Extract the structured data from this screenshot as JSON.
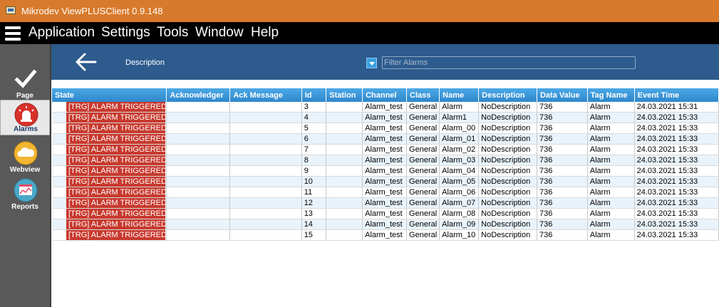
{
  "window": {
    "title": "Mikrodev ViewPLUSClient 0.9.148"
  },
  "menu": {
    "items": [
      "Application",
      "Settings",
      "Tools",
      "Window",
      "Help"
    ]
  },
  "sidebar": {
    "items": [
      {
        "label": "Page",
        "icon": "check-icon"
      },
      {
        "label": "Alarms",
        "icon": "alarm-light-icon",
        "active": true
      },
      {
        "label": "Webview",
        "icon": "cloud-icon"
      },
      {
        "label": "Reports",
        "icon": "report-chart-icon"
      }
    ]
  },
  "header": {
    "description_label": "Description",
    "filter_placeholder": "Filter Alarms"
  },
  "colors": {
    "accent": "#2d5b8d",
    "titlebar": "#d87a2c",
    "alarm": "#c8392e",
    "table_header": "#3a96d8"
  },
  "table": {
    "columns": [
      "State",
      "Acknowledger",
      "Ack Message",
      "Id",
      "Station",
      "Channel",
      "Class",
      "Name",
      "Description",
      "Data Value",
      "Tag Name",
      "Event Time"
    ],
    "rows": [
      [
        "[TRG] ALARM TRIGGERED",
        "",
        "",
        "3",
        "",
        "Alarm_test",
        "General",
        "Alarm",
        "NoDescription",
        "736",
        "Alarm",
        "24.03.2021 15:31"
      ],
      [
        "[TRG] ALARM TRIGGERED",
        "",
        "",
        "4",
        "",
        "Alarm_test",
        "General",
        "Alarm1",
        "NoDescription",
        "736",
        "Alarm",
        "24.03.2021 15:33"
      ],
      [
        "[TRG] ALARM TRIGGERED",
        "",
        "",
        "5",
        "",
        "Alarm_test",
        "General",
        "Alarm_00",
        "NoDescription",
        "736",
        "Alarm",
        "24.03.2021 15:33"
      ],
      [
        "[TRG] ALARM TRIGGERED",
        "",
        "",
        "6",
        "",
        "Alarm_test",
        "General",
        "Alarm_01",
        "NoDescription",
        "736",
        "Alarm",
        "24.03.2021 15:33"
      ],
      [
        "[TRG] ALARM TRIGGERED",
        "",
        "",
        "7",
        "",
        "Alarm_test",
        "General",
        "Alarm_02",
        "NoDescription",
        "736",
        "Alarm",
        "24.03.2021 15:33"
      ],
      [
        "[TRG] ALARM TRIGGERED",
        "",
        "",
        "8",
        "",
        "Alarm_test",
        "General",
        "Alarm_03",
        "NoDescription",
        "736",
        "Alarm",
        "24.03.2021 15:33"
      ],
      [
        "[TRG] ALARM TRIGGERED",
        "",
        "",
        "9",
        "",
        "Alarm_test",
        "General",
        "Alarm_04",
        "NoDescription",
        "736",
        "Alarm",
        "24.03.2021 15:33"
      ],
      [
        "[TRG] ALARM TRIGGERED",
        "",
        "",
        "10",
        "",
        "Alarm_test",
        "General",
        "Alarm_05",
        "NoDescription",
        "736",
        "Alarm",
        "24.03.2021 15:33"
      ],
      [
        "[TRG] ALARM TRIGGERED",
        "",
        "",
        "11",
        "",
        "Alarm_test",
        "General",
        "Alarm_06",
        "NoDescription",
        "736",
        "Alarm",
        "24.03.2021 15:33"
      ],
      [
        "[TRG] ALARM TRIGGERED",
        "",
        "",
        "12",
        "",
        "Alarm_test",
        "General",
        "Alarm_07",
        "NoDescription",
        "736",
        "Alarm",
        "24.03.2021 15:33"
      ],
      [
        "[TRG] ALARM TRIGGERED",
        "",
        "",
        "13",
        "",
        "Alarm_test",
        "General",
        "Alarm_08",
        "NoDescription",
        "736",
        "Alarm",
        "24.03.2021 15:33"
      ],
      [
        "[TRG] ALARM TRIGGERED",
        "",
        "",
        "14",
        "",
        "Alarm_test",
        "General",
        "Alarm_09",
        "NoDescription",
        "736",
        "Alarm",
        "24.03.2021 15:33"
      ],
      [
        "[TRG] ALARM TRIGGERED",
        "",
        "",
        "15",
        "",
        "Alarm_test",
        "General",
        "Alarm_10",
        "NoDescription",
        "736",
        "Alarm",
        "24.03.2021 15:33"
      ]
    ]
  }
}
